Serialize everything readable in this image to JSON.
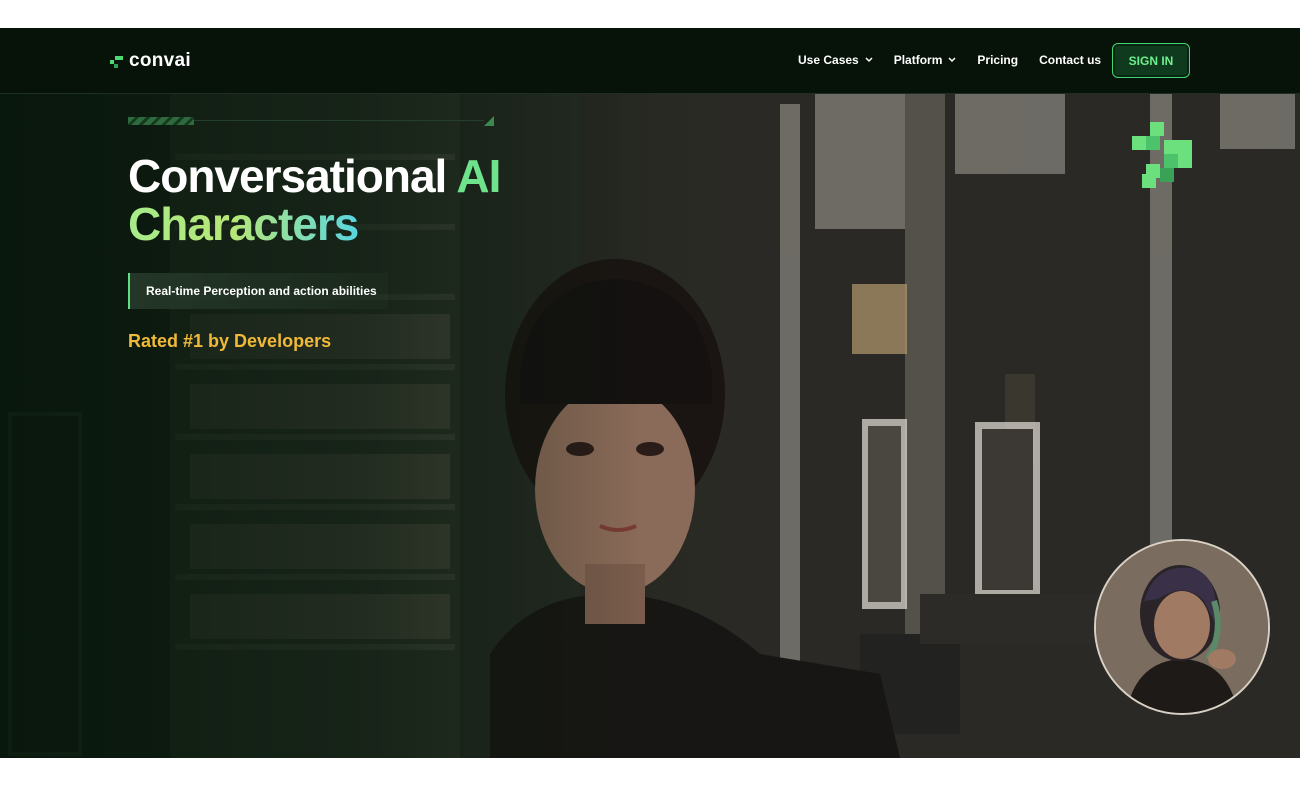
{
  "nav": {
    "logo_text": "convai",
    "items": [
      {
        "label": "Use Cases",
        "has_dropdown": true
      },
      {
        "label": "Platform",
        "has_dropdown": true
      },
      {
        "label": "Pricing",
        "has_dropdown": false
      },
      {
        "label": "Contact us",
        "has_dropdown": false
      }
    ],
    "signin_label": "SIGN IN"
  },
  "hero": {
    "title_part1": "Conversational ",
    "title_highlight": "AI",
    "title_line2": "Characters",
    "tagline": "Real-time Perception and action abilities",
    "rated": "Rated #1 by Developers"
  },
  "colors": {
    "nav_bg": "#071209",
    "accent_green": "#3fd472",
    "rated_gold": "#f0b93a"
  },
  "icons": {
    "logo": "convai-logo-icon",
    "dropdown": "chevron-down-icon",
    "brand": "convai-pixel-mark-icon"
  }
}
